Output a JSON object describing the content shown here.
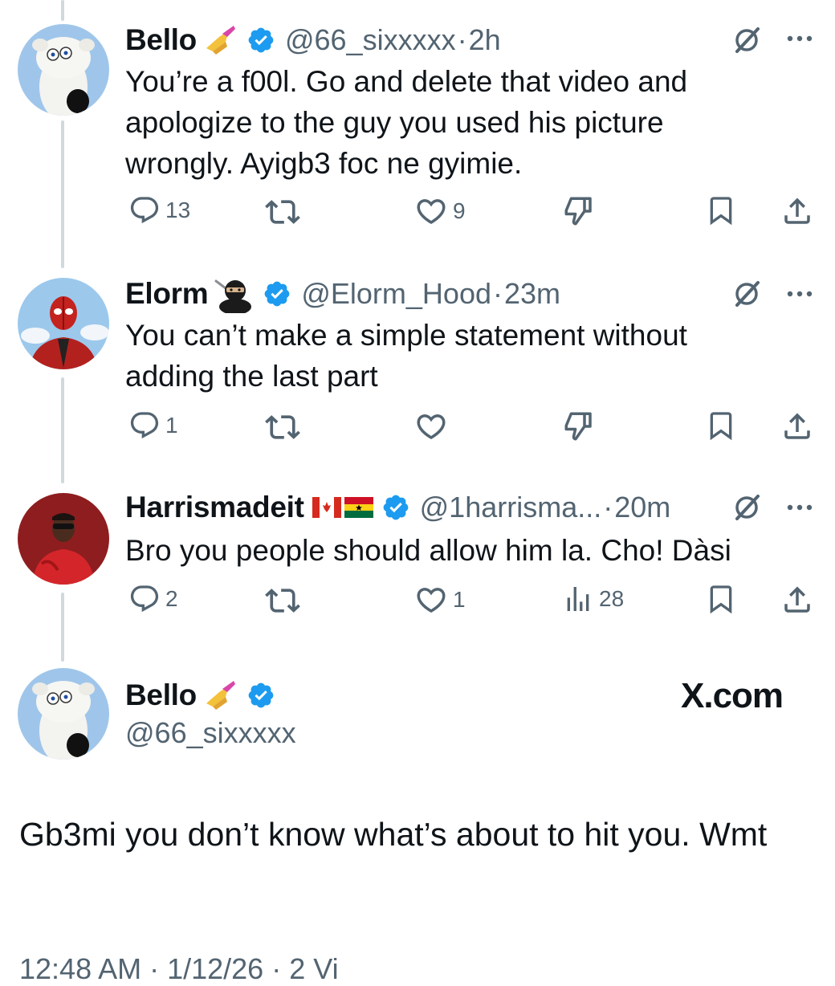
{
  "replies": [
    {
      "name": "Bello",
      "handle": "@66_sixxxxx",
      "dot": "·",
      "time": "2h",
      "text": "You’re a f00l. Go and delete that video and apologize to the guy you used his picture wrongly. Ayigb3 foc ne gyimie.",
      "replies_count": "13",
      "likes_count": "9"
    },
    {
      "name": "Elorm",
      "handle": "@Elorm_Hood",
      "dot": "·",
      "time": "23m",
      "text": "You can’t make a simple statement without adding the last part",
      "replies_count": "1"
    },
    {
      "name": "Harrismadeit",
      "handle": "@1harrisma...",
      "dot": "·",
      "time": "20m",
      "text": "Bro you people should allow him la. Cho! Dàsi",
      "replies_count": "2",
      "likes_count": "1",
      "views_count": "28"
    }
  ],
  "main_post": {
    "name": "Bello",
    "handle": "@66_sixxxxx",
    "brand": "X.com",
    "text": "Gb3mi you don’t know what’s about to hit you. Wmt",
    "footer_partial": "12:48 AM · 1/12/26 · 2 Vi"
  },
  "colors": {
    "verified": "#1d9bf0",
    "secondary_text": "#536471",
    "primary_text": "#0f1419",
    "thread_line": "#cfd9de"
  },
  "icons": [
    "verified-badge-icon",
    "grok-icon",
    "more-icon",
    "reply-icon",
    "repost-icon",
    "like-icon",
    "dislike-icon",
    "views-icon",
    "bookmark-icon",
    "share-icon"
  ]
}
